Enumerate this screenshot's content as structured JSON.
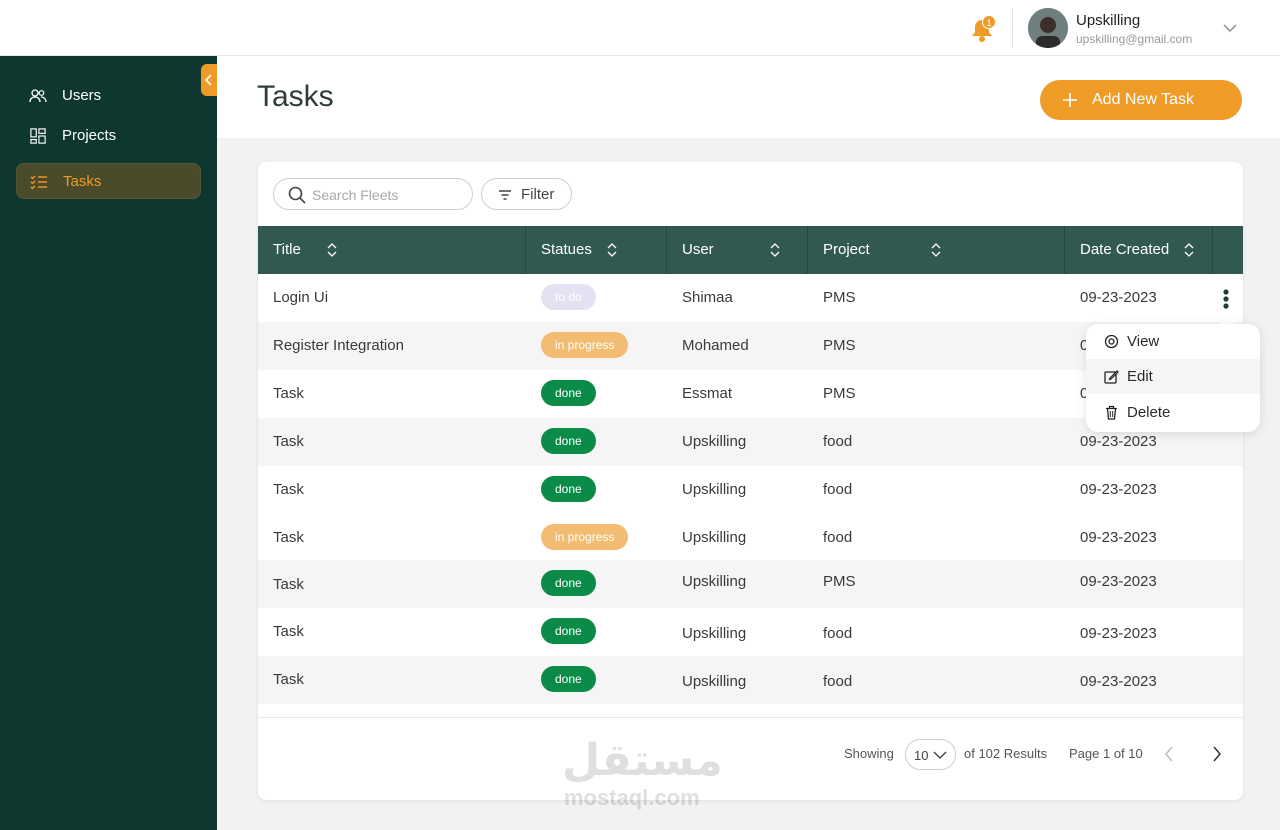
{
  "header": {
    "notification_count": "1",
    "user_name": "Upskilling",
    "user_email": "upskilling@gmail.com"
  },
  "sidebar": {
    "items": [
      {
        "label": "Users",
        "icon": "users-icon"
      },
      {
        "label": "Projects",
        "icon": "grid-icon"
      },
      {
        "label": "Tasks",
        "icon": "list-icon",
        "active": true
      }
    ]
  },
  "page": {
    "title": "Tasks",
    "add_button": "Add New Task"
  },
  "toolbar": {
    "search_placeholder": "Search Fleets",
    "filter_label": "Filter"
  },
  "table": {
    "columns": [
      "Title",
      "Statues",
      "User",
      "Project",
      "Date Created"
    ],
    "rows": [
      {
        "title": "Login Ui",
        "status": "to do",
        "status_type": "todo",
        "user": "Shimaa",
        "project": "PMS",
        "date": "09-23-2023"
      },
      {
        "title": "Register Integration",
        "status": "in progress",
        "status_type": "progress",
        "user": "Mohamed",
        "project": "PMS",
        "date": "09-23-2023"
      },
      {
        "title": "Task",
        "status": "done",
        "status_type": "done",
        "user": "Essmat",
        "project": "PMS",
        "date": "09-23-2023"
      },
      {
        "title": "Task",
        "status": "done",
        "status_type": "done",
        "user": "Upskilling",
        "project": "food",
        "date": "09-23-2023"
      },
      {
        "title": "Task",
        "status": "done",
        "status_type": "done",
        "user": "Upskilling",
        "project": "food",
        "date": "09-23-2023"
      },
      {
        "title": "Task",
        "status": "in progress",
        "status_type": "progress",
        "user": "Upskilling",
        "project": "food",
        "date": "09-23-2023"
      },
      {
        "title": "Task",
        "status": "done",
        "status_type": "done",
        "user": "Upskilling",
        "project": "PMS",
        "date": "09-23-2023"
      },
      {
        "title": "Task",
        "status": "done",
        "status_type": "done",
        "user": "Upskilling",
        "project": "food",
        "date": "09-23-2023"
      },
      {
        "title": "Task",
        "status": "done",
        "status_type": "done",
        "user": "Upskilling",
        "project": "food",
        "date": "09-23-2023"
      }
    ]
  },
  "row_menu": {
    "items": [
      {
        "label": "View",
        "icon": "eye-icon"
      },
      {
        "label": "Edit",
        "icon": "edit-icon"
      },
      {
        "label": "Delete",
        "icon": "trash-icon"
      }
    ]
  },
  "pagination": {
    "showing_label": "Showing",
    "page_size": "10",
    "results_text": "of 102 Results",
    "page_text": "Page 1 of 10"
  },
  "watermark": {
    "arabic": "مستقل",
    "latin": "mostaql.com"
  },
  "colors": {
    "sidebar": "#0e382f",
    "accent": "#ef9b28",
    "table_header": "#315951",
    "done": "#0a8c48",
    "in_progress": "#f2bc72",
    "to_do": "#e6e1f2"
  }
}
